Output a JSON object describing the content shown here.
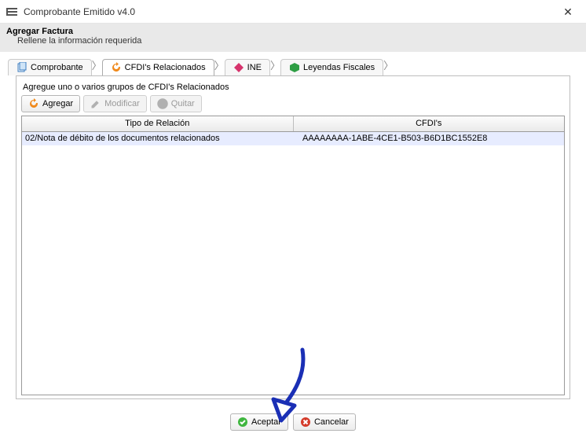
{
  "window": {
    "title": "Comprobante Emitido v4.0",
    "close_glyph": "✕"
  },
  "header": {
    "title": "Agregar Factura",
    "subtitle": "Rellene la información requerida"
  },
  "tabs": [
    {
      "id": "comprobante",
      "label": "Comprobante",
      "icon": "doc-stack-icon",
      "active": false
    },
    {
      "id": "cfdis",
      "label": "CFDI's Relacionados",
      "icon": "refresh-orange-icon",
      "active": true
    },
    {
      "id": "ine",
      "label": "INE",
      "icon": "diamond-pink-icon",
      "active": false
    },
    {
      "id": "leyendas",
      "label": "Leyendas Fiscales",
      "icon": "tag-green-icon",
      "active": false
    }
  ],
  "panel": {
    "instruction": "Agregue uno o varios grupos de CFDI's Relacionados",
    "toolbar": {
      "add": {
        "label": "Agregar",
        "enabled": true
      },
      "edit": {
        "label": "Modificar",
        "enabled": false
      },
      "remove": {
        "label": "Quitar",
        "enabled": false
      }
    },
    "table": {
      "columns": [
        "Tipo de Relación",
        "CFDI's"
      ],
      "rows": [
        {
          "selected": true,
          "tipo": "02/Nota de débito de los documentos relacionados",
          "cfdi": "AAAAAAAA-1ABE-4CE1-B503-B6D1BC1552E8"
        }
      ]
    }
  },
  "footer": {
    "accept": "Aceptar",
    "cancel": "Cancelar"
  },
  "colors": {
    "arrow": "#1a2fb5"
  }
}
